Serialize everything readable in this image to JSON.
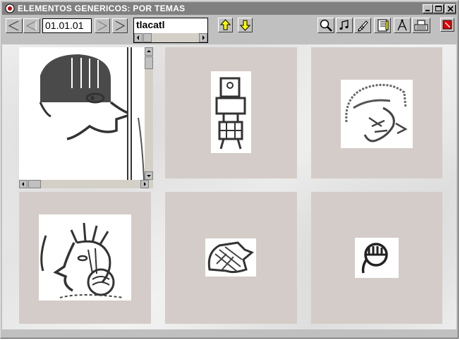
{
  "window": {
    "title": "ELEMENTOS GENERICOS: POR TEMAS"
  },
  "toolbar": {
    "date_value": "01.01.01",
    "search_word": "tlacatl"
  },
  "icons": {
    "title_icon": "app-logo-icon",
    "nav_first": "arrow-left-outline-icon",
    "nav_prev": "arrow-left-filled-icon",
    "nav_next": "arrow-right-outline-icon",
    "nav_last": "arrow-right-filled-icon",
    "up": "yellow-up-arrow-icon",
    "down": "yellow-down-arrow-icon",
    "tools": [
      "magnifier-icon",
      "music-note-icon",
      "pen-icon",
      "notebook-icon",
      "compass-icon",
      "keyboard-icon",
      "exit-icon"
    ]
  },
  "colors": {
    "titlebar": "#808080",
    "tile": "#d4ccc8",
    "arrow_yellow": "#ffff00",
    "exit_red": "#e00000"
  },
  "glyphs": [
    {
      "name": "profile-head-bangs"
    },
    {
      "name": "standing-figure"
    },
    {
      "name": "head-headdress-sketch"
    },
    {
      "name": "profile-head-feathers"
    },
    {
      "name": "hand-glyph"
    },
    {
      "name": "circle-teeth-glyph"
    }
  ]
}
